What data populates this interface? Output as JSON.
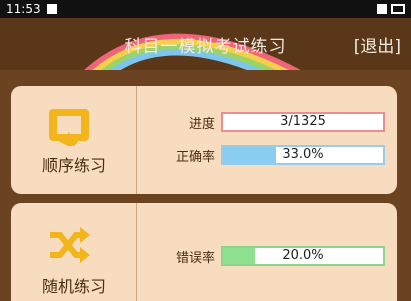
{
  "status_bar": {
    "time": "11:53"
  },
  "header": {
    "title": "科目一模拟考试练习",
    "exit_label": "[退出]"
  },
  "sequential": {
    "label": "顺序练习",
    "icon": "loop-icon",
    "progress_label": "进度",
    "progress_value": "3/1325",
    "progress_fraction": 0.0023,
    "accuracy_label": "正确率",
    "accuracy_value": "33.0%",
    "accuracy_fraction": 0.33
  },
  "random": {
    "label": "随机练习",
    "icon": "shuffle-icon",
    "error_label": "错误率",
    "error_value": "20.0%",
    "error_fraction": 0.2
  },
  "colors": {
    "header_bg": "#5a3719",
    "card_bg": "#f7dcc0",
    "icon_yellow": "#f2b51b",
    "accuracy_fill": "#89cdf1",
    "error_fill": "#91e090",
    "progress_border": "#ea8d95"
  }
}
